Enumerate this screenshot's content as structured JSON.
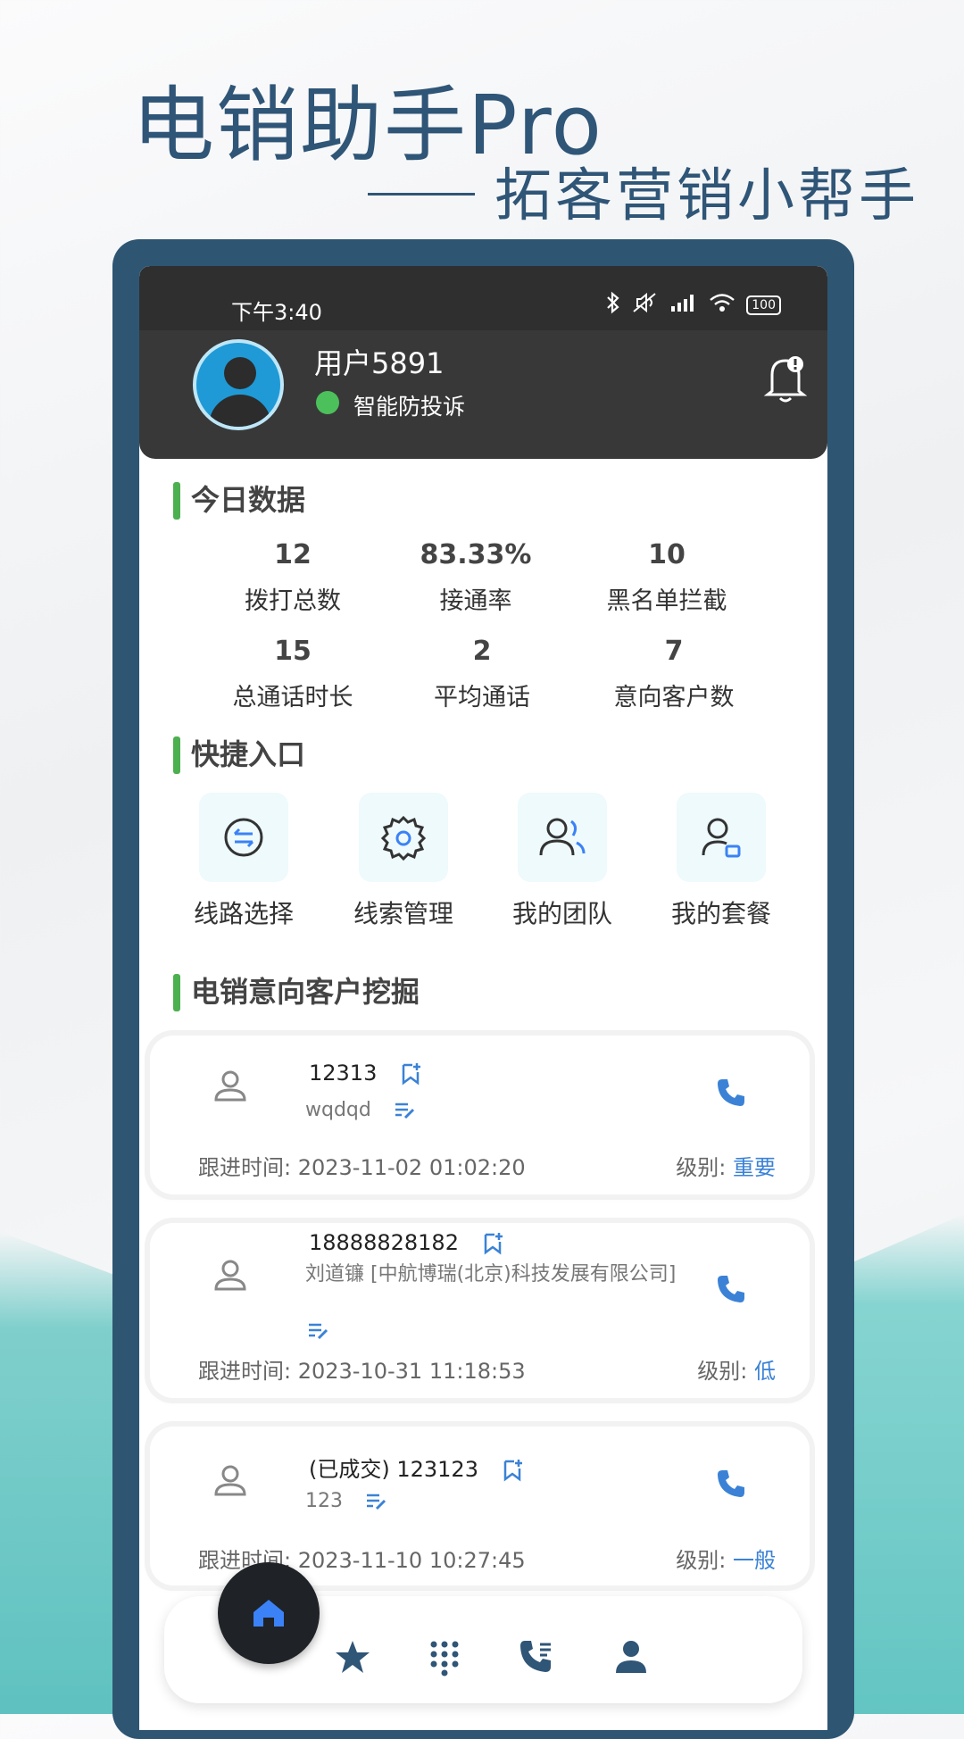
{
  "promo": {
    "title": "电销助手Pro",
    "subtitle": "拓客营销小帮手"
  },
  "status_bar": {
    "time": "下午3:40",
    "battery": "100"
  },
  "user": {
    "name": "用户5891",
    "status": "智能防投诉"
  },
  "today": {
    "title": "今日数据",
    "stats": [
      {
        "value": "12",
        "label": "拨打总数"
      },
      {
        "value": "83.33%",
        "label": "接通率"
      },
      {
        "value": "10",
        "label": "黑名单拦截"
      },
      {
        "value": "15",
        "label": "总通话时长"
      },
      {
        "value": "2",
        "label": "平均通话"
      },
      {
        "value": "7",
        "label": "意向客户数"
      }
    ]
  },
  "quick": {
    "title": "快捷入口",
    "items": [
      {
        "label": "线路选择",
        "icon": "route-switch-icon"
      },
      {
        "label": "线索管理",
        "icon": "gear-icon"
      },
      {
        "label": "我的团队",
        "icon": "team-icon"
      },
      {
        "label": "我的套餐",
        "icon": "package-user-icon"
      }
    ]
  },
  "leads": {
    "title": "电销意向客户挖掘",
    "items": [
      {
        "number": "12313",
        "desc": "wqdqd",
        "time": "跟进时间: 2023-11-02 01:02:20",
        "level_label": "级别: ",
        "level": "重要"
      },
      {
        "number": "18888828182",
        "desc": "刘道镰 [中航博瑞(北京)科技发展有限公司]",
        "time": "跟进时间: 2023-10-31 11:18:53",
        "level_label": "级别: ",
        "level": "低"
      },
      {
        "number": "(已成交) 123123",
        "desc": "123",
        "time": "跟进时间: 2023-11-10 10:27:45",
        "level_label": "级别: ",
        "level": "一般"
      }
    ]
  },
  "nav": {
    "items": [
      "home-icon",
      "star-icon",
      "dialpad-icon",
      "call-log-icon",
      "profile-icon"
    ],
    "active_color": "#3b82f6"
  },
  "colors": {
    "accent_green": "#4caf50",
    "link_blue": "#3b82d6",
    "frame": "#2e5673"
  }
}
